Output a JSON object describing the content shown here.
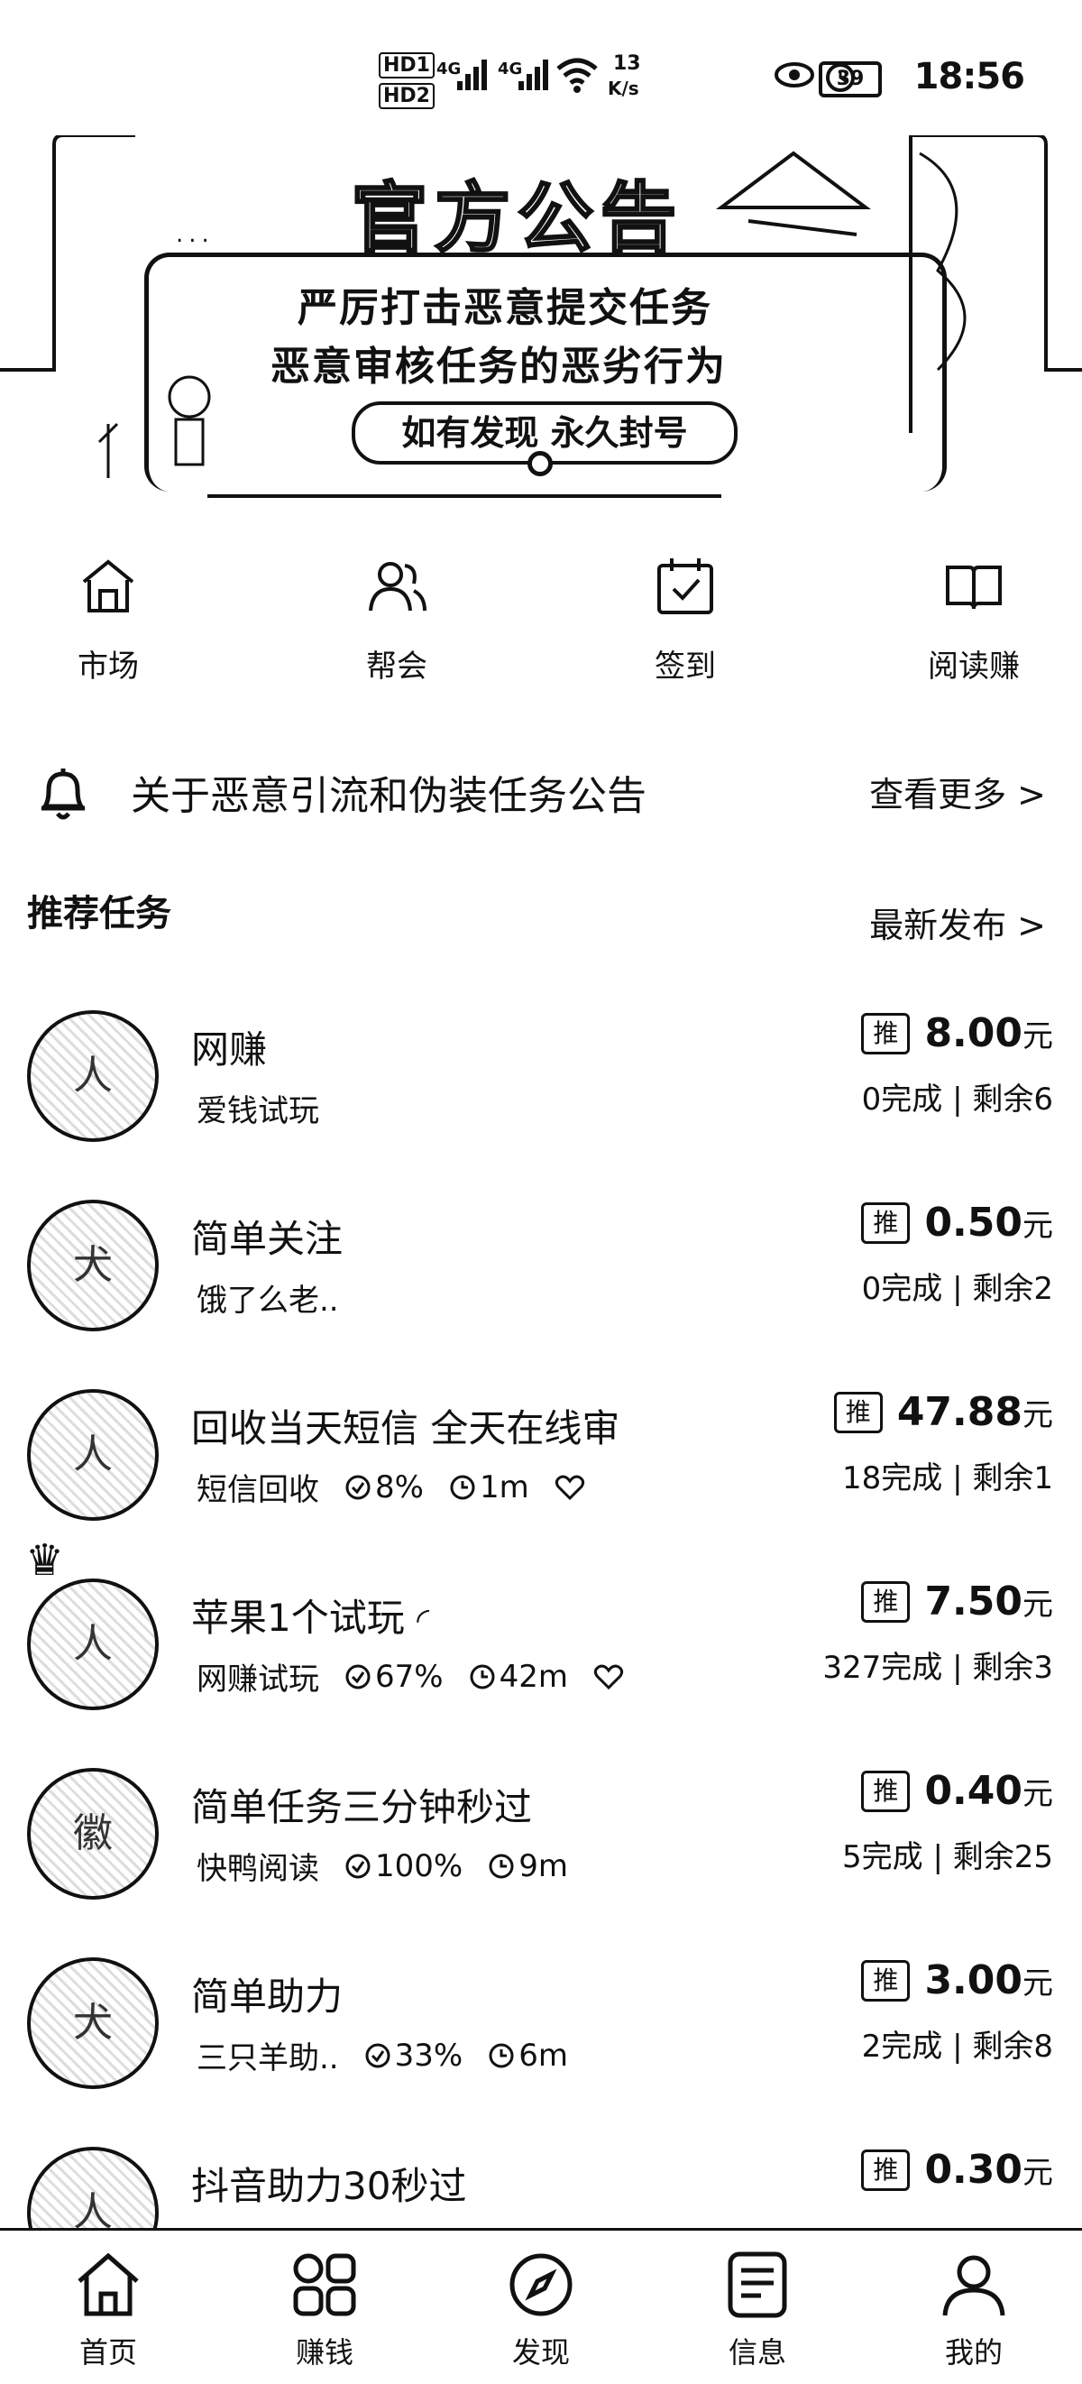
{
  "status_bar": {
    "hd1": "HD1",
    "hd2": "HD2",
    "signal1": "4G",
    "signal2": "4G",
    "speed_value": "13",
    "speed_unit": "K/s",
    "battery": "39",
    "time": "18:56"
  },
  "banner": {
    "title": "官方公告",
    "line1": "严厉打击恶意提交任务",
    "line2": "恶意审核任务的恶劣行为",
    "pill": "如有发现 永久封号",
    "dots": "..."
  },
  "quick_nav": [
    {
      "label": "市场",
      "icon": "market-icon"
    },
    {
      "label": "帮会",
      "icon": "group-icon"
    },
    {
      "label": "签到",
      "icon": "checkin-icon"
    },
    {
      "label": "阅读赚",
      "icon": "book-icon"
    }
  ],
  "notice": {
    "text": "关于恶意引流和伪装任务公告",
    "more": "查看更多 >",
    "icon": "bell-icon"
  },
  "section": {
    "title": "推荐任务",
    "more": "最新发布 >"
  },
  "tasks": [
    {
      "title": "网赚",
      "sub": "爱钱试玩",
      "rate": "",
      "time": "",
      "tag": "推",
      "price": "8.00",
      "unit": "元",
      "done": "0完成",
      "remain": "剩余6",
      "avatar": "人"
    },
    {
      "title": "简单关注",
      "sub": "饿了么老..",
      "rate": "",
      "time": "",
      "tag": "推",
      "price": "0.50",
      "unit": "元",
      "done": "0完成",
      "remain": "剩余2",
      "avatar": "犬"
    },
    {
      "title": "回收当天短信 全天在线审",
      "sub": "短信回收",
      "rate": "8%",
      "time": "1m",
      "tag": "推",
      "price": "47.88",
      "unit": "元",
      "done": "18完成",
      "remain": "剩余1",
      "avatar": "人"
    },
    {
      "title": "苹果1个试玩",
      "sub": "网赚试玩",
      "rate": "67%",
      "time": "42m",
      "tag": "推",
      "price": "7.50",
      "unit": "元",
      "done": "327完成",
      "remain": "剩余3",
      "avatar": "人"
    },
    {
      "title": "简单任务三分钟秒过",
      "sub": "快鸭阅读",
      "rate": "100%",
      "time": "9m",
      "tag": "推",
      "price": "0.40",
      "unit": "元",
      "done": "5完成",
      "remain": "剩余25",
      "avatar": "徽"
    },
    {
      "title": "简单助力",
      "sub": "三只羊助..",
      "rate": "33%",
      "time": "6m",
      "tag": "推",
      "price": "3.00",
      "unit": "元",
      "done": "2完成",
      "remain": "剩余8",
      "avatar": "犬"
    },
    {
      "title": "抖音助力30秒过",
      "sub": "",
      "rate": "",
      "time": "",
      "tag": "推",
      "price": "0.30",
      "unit": "元",
      "done": "",
      "remain": "",
      "avatar": "人"
    }
  ],
  "bottom_nav": [
    {
      "label": "首页",
      "icon": "home-icon"
    },
    {
      "label": "赚钱",
      "icon": "apps-icon"
    },
    {
      "label": "发现",
      "icon": "compass-icon"
    },
    {
      "label": "信息",
      "icon": "message-icon"
    },
    {
      "label": "我的",
      "icon": "profile-icon"
    }
  ]
}
